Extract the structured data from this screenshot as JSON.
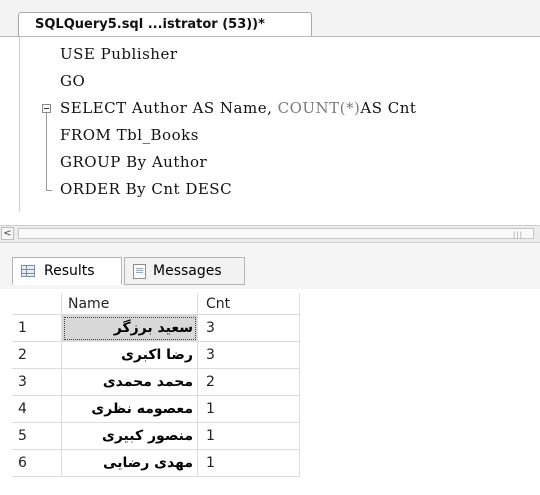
{
  "document_tab": {
    "title": "SQLQuery5.sql ...istrator (53))*"
  },
  "editor": {
    "lines": [
      {
        "text": "USE Publisher"
      },
      {
        "text": "GO"
      },
      {
        "text": "SELECT Author AS Name, ",
        "muted": "COUNT(*)",
        "rest": "AS Cnt"
      },
      {
        "text": "FROM Tbl_Books"
      },
      {
        "text": "GROUP By Author"
      },
      {
        "text": "ORDER By Cnt DESC"
      }
    ]
  },
  "scrollbar": {
    "left_arrow": "<"
  },
  "results": {
    "tabs": [
      {
        "label": "Results",
        "icon": "grid-icon",
        "active": true
      },
      {
        "label": "Messages",
        "icon": "messages-icon",
        "active": false
      }
    ],
    "columns": [
      "Name",
      "Cnt"
    ],
    "rows": [
      {
        "row": "1",
        "name": "سعید برزگر",
        "cnt": "3"
      },
      {
        "row": "2",
        "name": "رضا اکبری",
        "cnt": "3"
      },
      {
        "row": "3",
        "name": "محمد محمدی",
        "cnt": "2"
      },
      {
        "row": "4",
        "name": "معصومه نظری",
        "cnt": "1"
      },
      {
        "row": "5",
        "name": "منصور کبیری",
        "cnt": "1"
      },
      {
        "row": "6",
        "name": "مهدی رضایی",
        "cnt": "1"
      }
    ]
  }
}
